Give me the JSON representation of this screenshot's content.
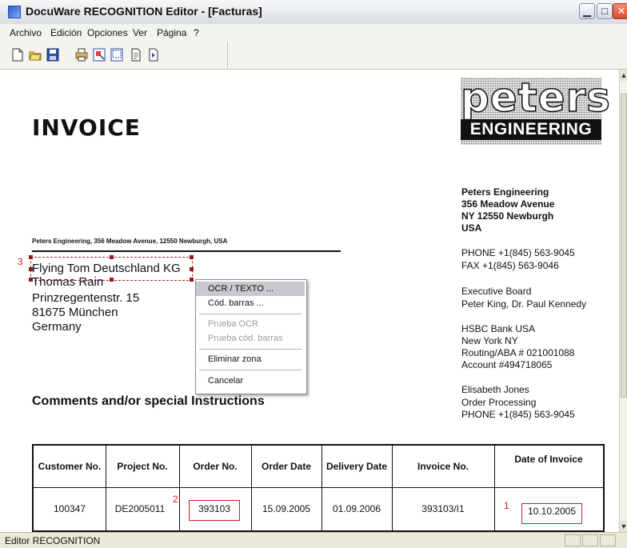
{
  "window": {
    "title": "DocuWare RECOGNITION Editor - [Facturas]",
    "min_label": "▁",
    "max_label": "□",
    "close_label": "✕"
  },
  "menu": [
    "Archivo",
    "Edición",
    "Opciones",
    "Ver",
    "Página",
    "?"
  ],
  "toolbar": {
    "icons": [
      "new-document-icon",
      "open-folder-icon",
      "save-icon",
      "print-icon",
      "zone-select-icon",
      "zone-frame-icon",
      "page-icon",
      "next-page-icon"
    ]
  },
  "document": {
    "logo": {
      "top": "peters",
      "bottom": "ENGINEERING"
    },
    "invoice_title": "INVOICE",
    "sender_line": "Peters Engineering, 356 Meadow Avenue, 12550 Newburgh, USA",
    "zone_marker": "3",
    "recipient": [
      "Flying Tom Deutschland KG",
      "Thomas Rain",
      "Prinzregentenstr. 15",
      "81675 München",
      "Germany"
    ],
    "comments_heading": "Comments and/or special Instructions",
    "company_info": [
      "Peters Engineering",
      "356 Meadow Avenue",
      "NY 12550 Newburgh",
      "USA",
      "PHONE  +1(845) 563-9045",
      "FAX      +1(845) 563-9046",
      "Executive Board",
      "Peter King, Dr. Paul Kennedy",
      "HSBC Bank USA",
      "New York NY",
      "Routing/ABA # 021001088",
      "Account #494718065",
      "Elisabeth Jones",
      "Order Processing",
      "PHONE  +1(845) 563-9045"
    ],
    "table": {
      "headers": [
        "Customer No.",
        "Project No.",
        "Order No.",
        "Order Date",
        "Delivery Date",
        "Invoice No.",
        "Date of Invoice"
      ],
      "row": [
        "100347",
        "DE2005011",
        "393103",
        "15.09.2005",
        "01.09.2006",
        "393103/I1",
        "10.10.2005"
      ],
      "marker_order": "2",
      "marker_date": "1"
    }
  },
  "context_menu": {
    "items": [
      "OCR / TEXTO ...",
      "Cód. barras ...",
      "Prueba OCR",
      "Prueba cód. barras",
      "Eliminar zona",
      "Cancelar"
    ]
  },
  "status": {
    "text": "Editor RECOGNITION"
  },
  "colors": {
    "zone_marker": "#e02020",
    "menu_highlight": "#c8c8d0",
    "title_accent": "#2a5bd7"
  }
}
